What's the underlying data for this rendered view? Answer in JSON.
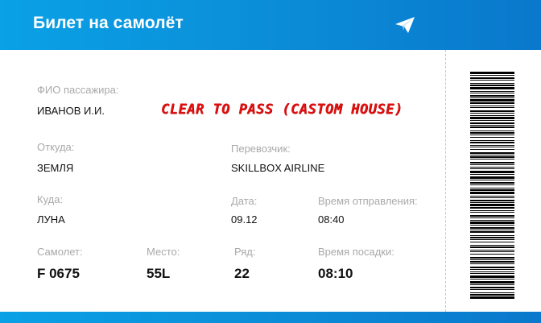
{
  "header": {
    "title": "Билет на самолёт",
    "icon": "paper-plane-icon"
  },
  "stamp": "CLEAR TO PASS (CASTOM HOUSE)",
  "passenger": {
    "label": "ФИО пассажира:",
    "value": "ИВАНОВ И.И."
  },
  "from": {
    "label": "Откуда:",
    "value": "ЗЕМЛЯ"
  },
  "carrier": {
    "label": "Перевозчик:",
    "value": "SKILLBOX AIRLINE"
  },
  "to": {
    "label": "Куда:",
    "value": "ЛУНА"
  },
  "date": {
    "label": "Дата:",
    "value": "09.12"
  },
  "departure": {
    "label": "Время отправления:",
    "value": "08:40"
  },
  "plane": {
    "label": "Самолет:",
    "value": "F 0675"
  },
  "seat": {
    "label": "Место:",
    "value": "55L"
  },
  "row": {
    "label": "Ряд:",
    "value": "22"
  },
  "boarding": {
    "label": "Время посадки:",
    "value": "08:10"
  },
  "colors": {
    "accent": "#0b8fd9",
    "stamp": "#e01010",
    "label": "#a9a9a9"
  }
}
